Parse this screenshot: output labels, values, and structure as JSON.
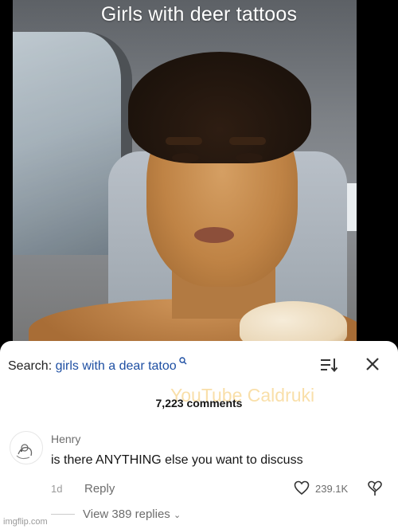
{
  "video": {
    "caption": "Girls with deer tattoos"
  },
  "comments_panel": {
    "search_label": "Search:",
    "search_query": "girls with a dear tatoo",
    "comment_count": "7,223 comments",
    "watermark": "YouTube Caldruki",
    "icons": {
      "search": "search-icon",
      "sort": "sort-icon",
      "close": "close-icon",
      "like": "heart-icon",
      "dislike": "dislike-icon"
    }
  },
  "comment": {
    "author": "Henry",
    "text": "is there ANYTHING else you want to discuss",
    "age": "1d",
    "reply_label": "Reply",
    "likes": "239.1K",
    "view_replies": "View 389 replies"
  },
  "footer": {
    "imgflip": "imgflip.com"
  },
  "colors": {
    "query": "#1e4fa3",
    "watermark": "#f0aa1e"
  }
}
